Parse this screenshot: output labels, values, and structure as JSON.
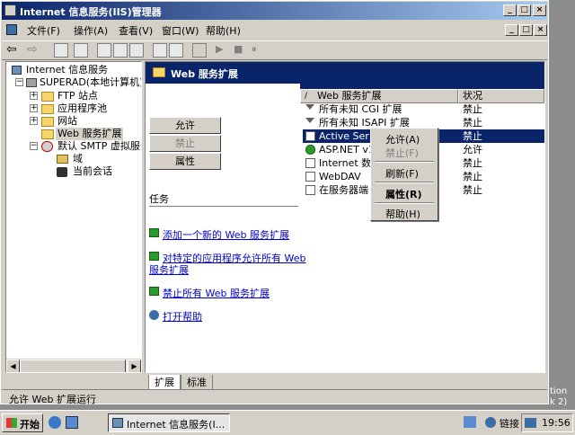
{
  "window": {
    "title": "Internet 信息服务(IIS)管理器",
    "min": "_",
    "max": "□",
    "close": "×"
  },
  "menubar": {
    "items": [
      "文件(F)",
      "操作(A)",
      "查看(V)",
      "窗口(W)",
      "帮助(H)"
    ],
    "inner_min": "_",
    "inner_max": "□",
    "inner_close": "×"
  },
  "toolbar": {
    "back": "⇦",
    "forward": "⇨",
    "play": "▶",
    "stop": "■",
    "pause": "⏸"
  },
  "tree": {
    "items": [
      {
        "label": "Internet 信息服务"
      },
      {
        "label": "SUPERAD(本地计算机)"
      },
      {
        "label": "FTP 站点"
      },
      {
        "label": "应用程序池"
      },
      {
        "label": "网站"
      },
      {
        "label": "Web 服务扩展"
      },
      {
        "label": "默认 SMTP 虚拟服务"
      },
      {
        "label": "域"
      },
      {
        "label": "当前会话"
      }
    ]
  },
  "panel": {
    "title": "Web 服务扩展",
    "buttons": {
      "allow": "允许",
      "deny": "禁止",
      "properties": "属性"
    },
    "tasks_label": "任务",
    "tasks": [
      "添加一个新的 Web 服务扩展",
      "对特定的应用程序允许所有 Web",
      "服务扩展",
      "禁止所有 Web 服务扩展",
      "打开帮助"
    ]
  },
  "list": {
    "columns": [
      "Web 服务扩展",
      "状况"
    ],
    "rows": [
      {
        "name": "所有未知 CGI 扩展",
        "status": "禁止"
      },
      {
        "name": "所有未知 ISAPI 扩展",
        "status": "禁止"
      },
      {
        "name": "Active Ser",
        "status": "禁止"
      },
      {
        "name": "ASP.NET v1",
        "status": "允许"
      },
      {
        "name": "Internet 数",
        "status": "禁止"
      },
      {
        "name": "WebDAV",
        "status": "禁止"
      },
      {
        "name": "在服务器端",
        "status": "禁止"
      }
    ]
  },
  "context_menu": {
    "items": [
      "允许(A)",
      "禁止(F)",
      "刷新(F)",
      "属性(R)",
      "帮助(H)"
    ]
  },
  "tabs": {
    "extended": "扩展",
    "standard": "标准"
  },
  "status_bar": {
    "text": "允许 Web 扩展运行"
  },
  "taskbar": {
    "start": "开始",
    "task": "Internet 信息服务(I...",
    "links": "链接",
    "clock": "19:56"
  },
  "background": {
    "fragment_1": "tion",
    "fragment_2": "k 2)"
  }
}
